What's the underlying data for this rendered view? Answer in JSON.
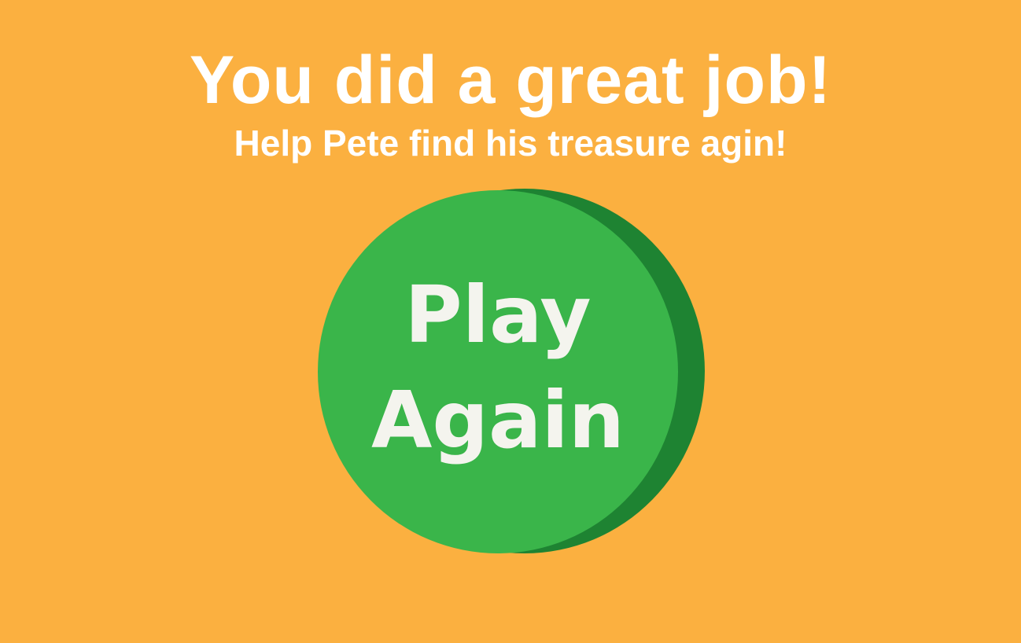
{
  "colors": {
    "background": "#FBB040",
    "text": "#FFFFFF",
    "button_face": "#3AB54A",
    "button_shadow": "#1E8332"
  },
  "end_screen": {
    "headline": "You did a great job!",
    "subline": "Help Pete find his treasure agin!"
  },
  "play_again_button": {
    "label_line1": "Play",
    "label_line2": "Again"
  }
}
